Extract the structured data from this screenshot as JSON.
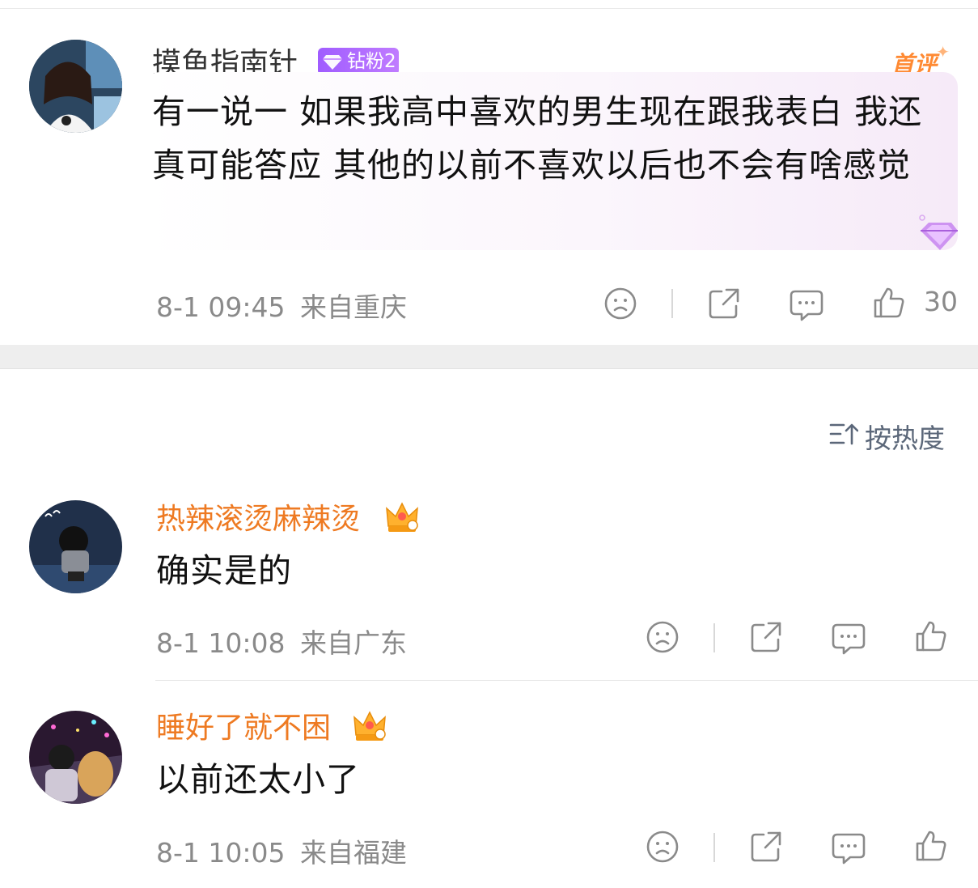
{
  "main_comment": {
    "username": "摸鱼指南针",
    "badge_label": "钻粉2",
    "first_label": "首评",
    "text": "有一说一 如果我高中喜欢的男生现在跟我表白 我还真可能答应 其他的以前不喜欢以后也不会有啥感觉",
    "timestamp": "8-1 09:45",
    "location": "来自重庆",
    "like_count": "30"
  },
  "sort": {
    "label": "按热度"
  },
  "replies": [
    {
      "username": "热辣滚烫麻辣烫",
      "text": "确实是的",
      "timestamp": "8-1 10:08",
      "location": "来自广东"
    },
    {
      "username": "睡好了就不困",
      "text": "以前还太小了",
      "timestamp": "8-1 10:05",
      "location": "来自福建"
    }
  ],
  "colors": {
    "username_reply": "#ee7a22",
    "badge_purple": "#a05cff",
    "first_review": "#ff8a33",
    "meta_gray": "#8a8a8a"
  },
  "icons": [
    "sad-face-icon",
    "share-icon",
    "comment-icon",
    "thumbs-up-icon",
    "sort-icon",
    "crown-icon",
    "diamond-icon"
  ]
}
